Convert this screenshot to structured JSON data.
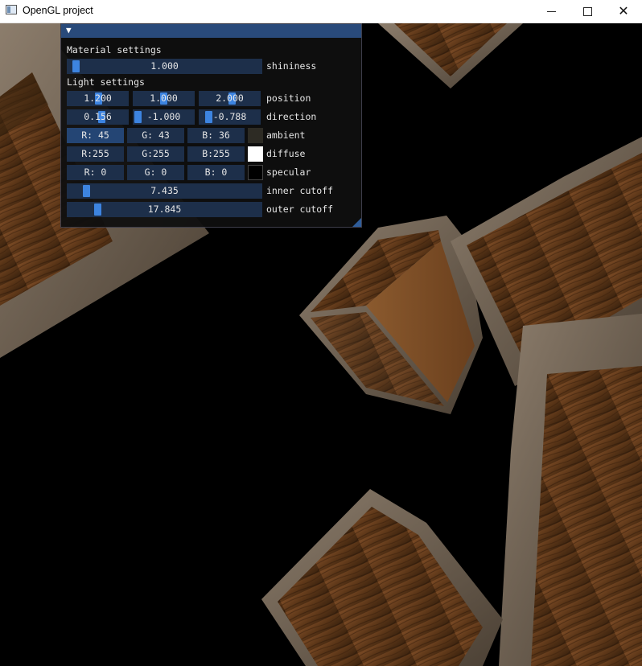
{
  "window": {
    "title": "OpenGL project"
  },
  "panel": {
    "collapse_glyph": "▼",
    "material_header": "Material settings",
    "light_header": "Light settings",
    "shininess": {
      "value": "1.000",
      "label": "shininess",
      "fraction": 0.02
    },
    "position": {
      "values": [
        "1.200",
        "1.000",
        "2.000"
      ],
      "fractions": [
        0.52,
        0.5,
        0.55
      ],
      "label": "position"
    },
    "direction": {
      "values": [
        "0.156",
        "-1.000",
        "-0.788"
      ],
      "fractions": [
        0.58,
        0.0,
        0.1
      ],
      "label": "direction"
    },
    "ambient": {
      "r": "R: 45",
      "g": "G: 43",
      "b": "B: 36",
      "label": "ambient",
      "color": "#2d2b24"
    },
    "diffuse": {
      "r": "R:255",
      "g": "G:255",
      "b": "B:255",
      "label": "diffuse",
      "color": "#ffffff"
    },
    "specular": {
      "r": "R:  0",
      "g": "G:  0",
      "b": "B:  0",
      "label": "specular",
      "color": "#000000"
    },
    "inner_cutoff": {
      "value": "7.435",
      "label": "inner cutoff",
      "fraction": 0.08
    },
    "outer_cutoff": {
      "value": "17.845",
      "label": "outer cutoff",
      "fraction": 0.14
    }
  },
  "colors": {
    "slider_bg": "#1d2f4a",
    "grab": "#3d84e0",
    "title_active": "#294a7a",
    "window_bg": "#0f0f0f"
  }
}
